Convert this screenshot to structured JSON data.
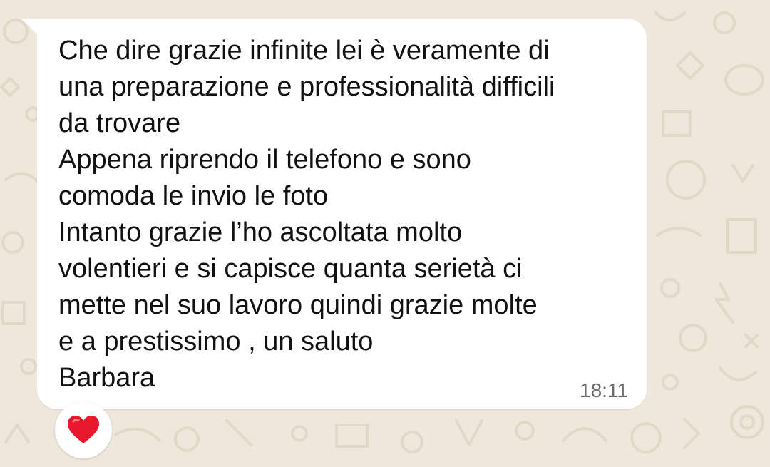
{
  "message": {
    "lines": [
      "Che dire grazie infinite lei è veramente di",
      "una preparazione e professionalità difficili",
      "da trovare",
      "Appena riprendo il telefono e sono",
      "comoda le invio le foto",
      "Intanto grazie l’ho ascoltata molto",
      "volentieri e si capisce quanta serietà ci",
      "mette nel suo lavoro quindi grazie molte",
      "e a prestissimo , un saluto",
      "Barbara"
    ],
    "time": "18:11"
  },
  "reaction": {
    "icon": "heart-icon",
    "color": "#e8192c"
  },
  "theme": {
    "wallpaper": "#efe7dc",
    "bubble": "#ffffff",
    "text": "#111111",
    "timestamp": "#6b6b6b"
  }
}
